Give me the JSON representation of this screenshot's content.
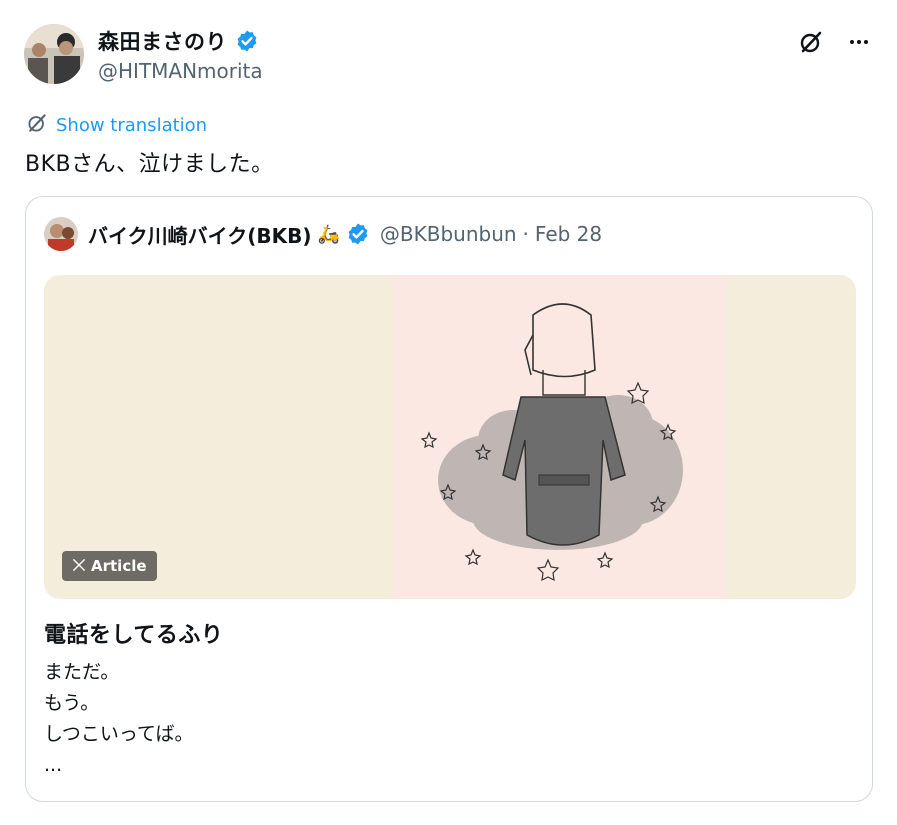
{
  "author": {
    "display_name": "森田まさのり",
    "handle": "@HITMANmorita",
    "verified": true
  },
  "actions": {
    "show_translation": "Show translation"
  },
  "tweet": {
    "text": "BKBさん、泣けました。"
  },
  "quote": {
    "display_name": "バイク川崎バイク(BKB)",
    "name_emoji": "🛵",
    "handle": "@BKBbunbun",
    "separator": "·",
    "date": "Feb 28",
    "badge": "Article",
    "article_title": "電話をしてるふり",
    "article_lines": [
      "まただ。",
      "もう。",
      "しつこいってば。",
      "..."
    ]
  },
  "colors": {
    "verified": "#1d9bf0",
    "link": "#1d9bf0",
    "secondary_text": "#536471",
    "media_bg": "#f5eddb",
    "media_center": "#fbe8e2",
    "border": "#cfd9de"
  },
  "icons": {
    "grok": "grok-icon",
    "more": "more-horizontal-icon",
    "verified": "verified-badge-icon",
    "x_logo": "x-logo-icon",
    "translate": "grok-translate-icon"
  }
}
